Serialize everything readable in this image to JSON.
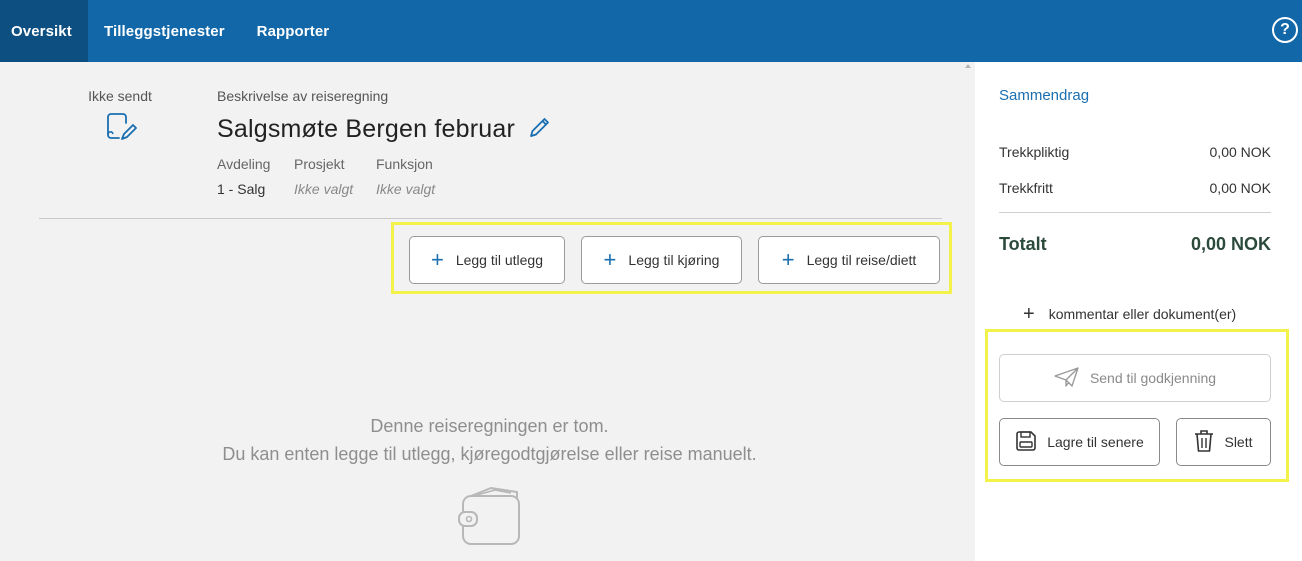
{
  "nav": {
    "tabs": [
      {
        "label": "Oversikt",
        "active": true
      },
      {
        "label": "Tilleggstjenester",
        "active": false
      },
      {
        "label": "Rapporter",
        "active": false
      }
    ],
    "help_icon": "question-mark-icon",
    "help_label": "?"
  },
  "report": {
    "status": "Ikke sendt",
    "description_label": "Beskrivelse av reiseregning",
    "title": "Salgsmøte Bergen februar",
    "fields": [
      {
        "label": "Avdeling",
        "value": "1 - Salg"
      },
      {
        "label": "Prosjekt",
        "value": "Ikke valgt"
      },
      {
        "label": "Funksjon",
        "value": "Ikke valgt"
      }
    ]
  },
  "actions": {
    "add_expense": "Legg til utlegg",
    "add_mileage": "Legg til kjøring",
    "add_travel": "Legg til reise/diett"
  },
  "empty": {
    "line1": "Denne reiseregningen er tom.",
    "line2": "Du kan enten legge til utlegg, kjøregodtgjørelse eller reise manuelt."
  },
  "summary": {
    "title": "Sammendrag",
    "taxable_label": "Trekkpliktig",
    "taxable_value": "0,00 NOK",
    "nontaxable_label": "Trekkfritt",
    "nontaxable_value": "0,00 NOK",
    "total_label": "Totalt",
    "total_value": "0,00 NOK",
    "comment_label": "kommentar eller dokument(er)",
    "send_label": "Send til godkjenning",
    "save_label": "Lagre til senere",
    "delete_label": "Slett"
  },
  "colors": {
    "nav_bg": "#1167a8",
    "nav_active": "#0d4f80",
    "accent": "#1a6fb0",
    "highlight": "#f2f24a"
  }
}
